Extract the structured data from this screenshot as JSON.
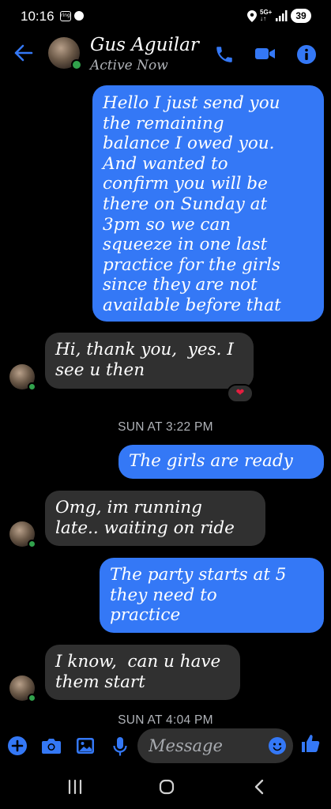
{
  "status_bar": {
    "time": "10:16",
    "ring_badge": "ring",
    "network": "5G+",
    "network_sub": "↓↑",
    "battery": "39"
  },
  "header": {
    "contact_name": "Gus Aguilar",
    "contact_status": "Active Now",
    "accent_color": "#3478f6"
  },
  "messages": [
    {
      "direction": "outgoing",
      "lines": [
        "Hello I just send you",
        "the remaining",
        "balance I owed you.",
        "And wanted to",
        "confirm you will be",
        "there on Sunday at",
        "3pm so we can",
        "squeeze in one last",
        "practice for the girls",
        "since they are not",
        "available before that"
      ]
    },
    {
      "direction": "incoming",
      "lines": [
        "Hi, thank you,  yes. I",
        "see u then"
      ],
      "reaction": "❤"
    },
    {
      "direction": "outgoing",
      "lines": [
        "The girls are ready"
      ]
    },
    {
      "direction": "incoming",
      "lines": [
        "Omg, im running",
        "late.. waiting on ride"
      ]
    },
    {
      "direction": "outgoing",
      "lines": [
        "The party starts at 5",
        "they need to",
        "practice"
      ]
    },
    {
      "direction": "incoming",
      "lines": [
        "I know,  can u have",
        "them start"
      ]
    }
  ],
  "timestamps": [
    "SUN AT 3:22 PM",
    "SUN AT 4:04 PM"
  ],
  "composer": {
    "placeholder": "Message"
  },
  "icons": {
    "header": [
      "back-arrow-icon",
      "phone-icon",
      "video-camera-icon",
      "info-icon"
    ],
    "composer": [
      "plus-icon",
      "camera-icon",
      "image-icon",
      "microphone-icon",
      "emoji-icon",
      "thumbs-up-icon"
    ],
    "nav": [
      "recent-apps-icon",
      "home-icon",
      "back-icon"
    ]
  }
}
